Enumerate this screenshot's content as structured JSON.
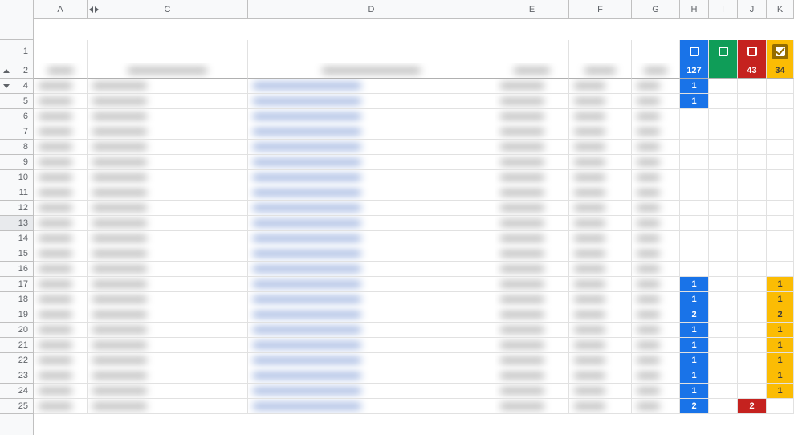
{
  "columns": [
    "A",
    "C",
    "D",
    "E",
    "F",
    "G",
    "H",
    "I",
    "J",
    "K"
  ],
  "row_labels": [
    "1",
    "2",
    "4",
    "5",
    "6",
    "7",
    "8",
    "9",
    "10",
    "11",
    "12",
    "13",
    "14",
    "15",
    "16",
    "17",
    "18",
    "19",
    "20",
    "21",
    "22",
    "23",
    "24",
    "25"
  ],
  "header_icons": {
    "H": "square",
    "I": "square",
    "J": "square",
    "K": "check"
  },
  "header_fills": {
    "H": "blue",
    "I": "green",
    "J": "red",
    "K": "yellow"
  },
  "totals": {
    "H": "127",
    "I": "",
    "J": "43",
    "K": "34"
  },
  "data": {
    "4": {
      "H": "1",
      "I": "",
      "J": "",
      "K": ""
    },
    "5": {
      "H": "1",
      "I": "",
      "J": "",
      "K": ""
    },
    "17": {
      "H": "1",
      "I": "",
      "J": "",
      "K": "1"
    },
    "18": {
      "H": "1",
      "I": "",
      "J": "",
      "K": "1"
    },
    "19": {
      "H": "2",
      "I": "",
      "J": "",
      "K": "2"
    },
    "20": {
      "H": "1",
      "I": "",
      "J": "",
      "K": "1"
    },
    "21": {
      "H": "1",
      "I": "",
      "J": "",
      "K": "1"
    },
    "22": {
      "H": "1",
      "I": "",
      "J": "",
      "K": "1"
    },
    "23": {
      "H": "1",
      "I": "",
      "J": "",
      "K": "1"
    },
    "24": {
      "H": "1",
      "I": "",
      "J": "",
      "K": "1"
    },
    "25": {
      "H": "2",
      "I": "",
      "J": "2",
      "K": ""
    }
  },
  "selected_row": "13"
}
